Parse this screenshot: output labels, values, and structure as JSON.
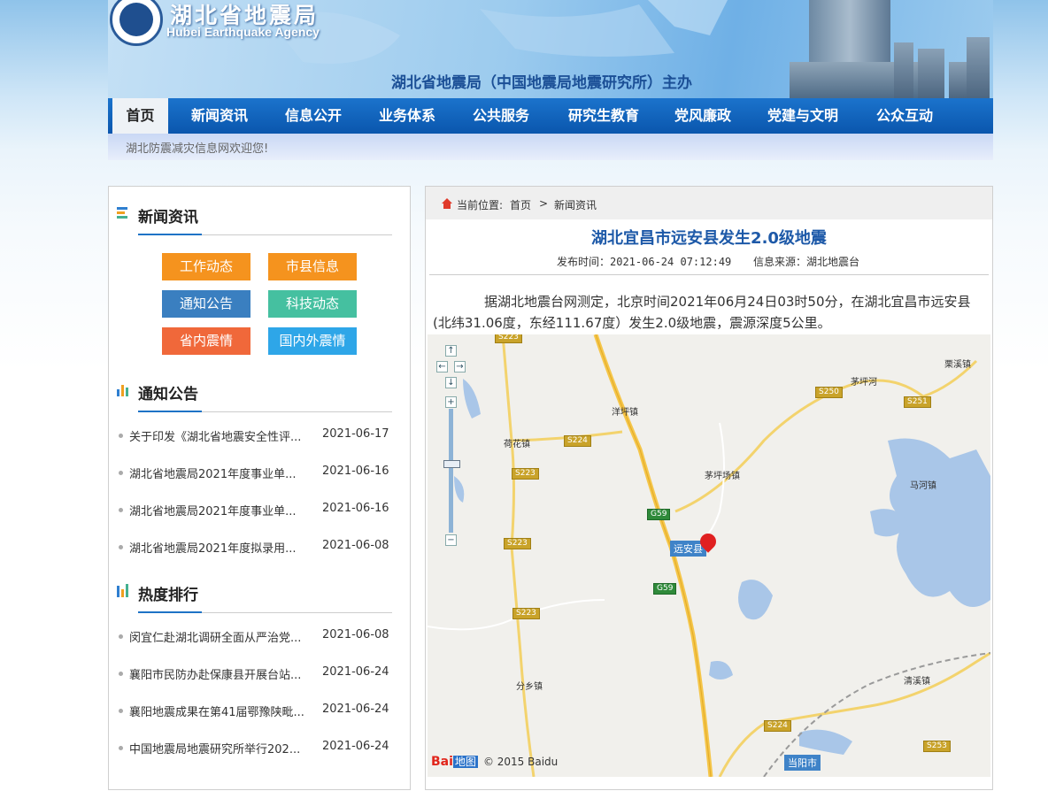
{
  "header": {
    "agency_cn": "湖北省地震局",
    "agency_en": "Hubei Earthquake Agency",
    "sponsor": "湖北省地震局（中国地震局地震研究所）主办"
  },
  "nav": {
    "items": [
      {
        "label": "首页",
        "active": true
      },
      {
        "label": "新闻资讯"
      },
      {
        "label": "信息公开"
      },
      {
        "label": "业务体系"
      },
      {
        "label": "公共服务"
      },
      {
        "label": "研究生教育"
      },
      {
        "label": "党风廉政"
      },
      {
        "label": "党建与文明"
      },
      {
        "label": "公众互动"
      }
    ]
  },
  "welcome": "湖北防震减灾信息网欢迎您!",
  "sidebar": {
    "news": {
      "title": "新闻资讯",
      "buttons": [
        {
          "label": "工作动态",
          "color": "#f5931e"
        },
        {
          "label": "市县信息",
          "color": "#f5931e"
        },
        {
          "label": "通知公告",
          "color": "#3a7fc0"
        },
        {
          "label": "科技动态",
          "color": "#45c0a0"
        },
        {
          "label": "省内震情",
          "color": "#f0683a"
        },
        {
          "label": "国内外震情",
          "color": "#2ea6e8"
        }
      ]
    },
    "notices": {
      "title": "通知公告",
      "items": [
        {
          "title": "关于印发《湖北省地震安全性评...",
          "date": "2021-06-17"
        },
        {
          "title": "湖北省地震局2021年度事业单...",
          "date": "2021-06-16"
        },
        {
          "title": "湖北省地震局2021年度事业单...",
          "date": "2021-06-16"
        },
        {
          "title": "湖北省地震局2021年度拟录用...",
          "date": "2021-06-08"
        }
      ]
    },
    "hot": {
      "title": "热度排行",
      "items": [
        {
          "title": "闵宜仁赴湖北调研全面从严治党...",
          "date": "2021-06-08"
        },
        {
          "title": "襄阳市民防办赴保康县开展台站...",
          "date": "2021-06-24"
        },
        {
          "title": "襄阳地震成果在第41届鄂豫陕毗...",
          "date": "2021-06-24"
        },
        {
          "title": "中国地震局地震研究所举行202...",
          "date": "2021-06-24"
        }
      ]
    }
  },
  "article": {
    "breadcrumb": {
      "prefix": "当前位置:",
      "home": "首页",
      "sep": ">",
      "current": "新闻资讯"
    },
    "title": "湖北宜昌市远安县发生2.0级地震",
    "publish": "发布时间：2021-06-24 07:12:49",
    "source": "信息来源：湖北地震台",
    "body": "据湖北地震台网测定，北京时间2021年06月24日03时50分，在湖北宜昌市远安县(北纬31.06度，东经111.67度）发生2.0级地震，震源深度5公里。"
  },
  "map": {
    "place_labels": [
      "洋坪镇",
      "荷花镇",
      "茅坪河",
      "栗溪镇",
      "茅坪场镇",
      "马河镇",
      "分乡镇",
      "清溪镇"
    ],
    "road_shields": [
      "S223",
      "S224",
      "S223",
      "S250",
      "S251",
      "G59",
      "S223",
      "G59",
      "S223",
      "S224",
      "S253"
    ],
    "county": "远安县",
    "city": "当阳市",
    "copyright": "© 2015 Baidu",
    "logo_text": "Bai",
    "logo_suffix": "地图"
  }
}
